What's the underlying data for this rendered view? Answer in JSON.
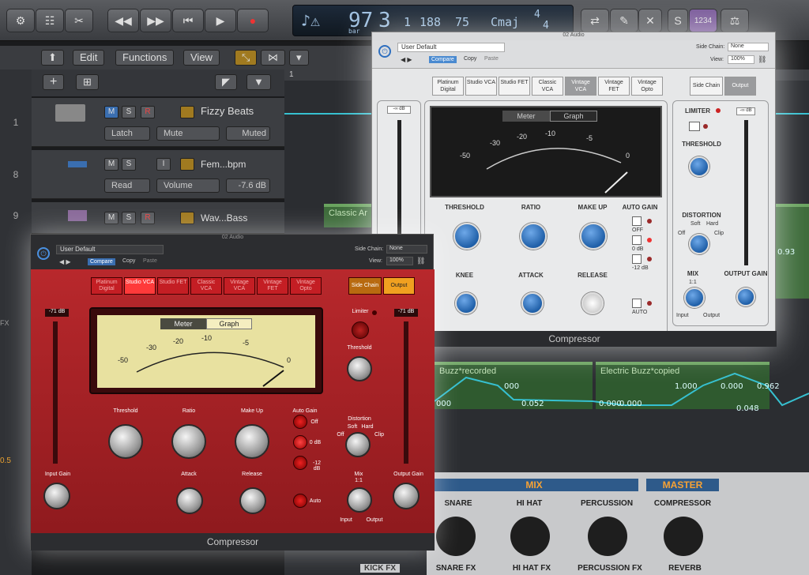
{
  "transport": {
    "bar": "97",
    "beat": "3",
    "division": "1",
    "tick": "188",
    "tempo": "75",
    "key": "Cmaj",
    "sig_top": "4",
    "sig_bottom": "4",
    "lcd_sub": "bar",
    "counter": "1234"
  },
  "toolbar": {
    "edit": "Edit",
    "functions": "Functions",
    "view": "View"
  },
  "tracks": [
    {
      "num": "1",
      "name": "Fizzy Beats",
      "m": "M",
      "s": "S",
      "r": "R",
      "mode": "Latch",
      "param": "Mute",
      "value": "Muted"
    },
    {
      "num": "8",
      "name": "Fem...bpm",
      "m": "M",
      "s": "S",
      "r": "I",
      "mode": "Read",
      "param": "Volume",
      "value": "-7.6 dB"
    },
    {
      "num": "9",
      "name": "Wav...Bass",
      "m": "M",
      "s": "S",
      "r": "R"
    }
  ],
  "ruler": {
    "start": "1"
  },
  "regions": {
    "classic": "Classic Ar",
    "buzz_rec": "Buzz*recorded",
    "buzz_copy": "Electric Buzz*copied",
    "side_val": "0.93"
  },
  "auto_values": [
    "000",
    "0.052",
    "000",
    "0.000",
    "0.000",
    "1.000",
    "0.000",
    "0.048",
    "0.962"
  ],
  "white_plugin": {
    "window": "02 Audio",
    "preset": "User Default",
    "compare": "Compare",
    "copy": "Copy",
    "paste": "Paste",
    "sidechain_label": "Side Chain:",
    "sidechain_val": "None",
    "view_label": "View:",
    "view_val": "100%",
    "models": [
      "Platinum Digital",
      "Studio VCA",
      "Studio FET",
      "Classic VCA",
      "Vintage VCA",
      "Vintage FET",
      "Vintage Opto"
    ],
    "active_model": "Vintage VCA",
    "side_chain_btn": "Side Chain",
    "output_btn": "Output",
    "in_db": "-∞ dB",
    "out_db": "-∞ dB",
    "meter_tab": "Meter",
    "graph_tab": "Graph",
    "vu_ticks": [
      "-50",
      "-30",
      "-20",
      "-10",
      "-5",
      "0"
    ],
    "threshold": "THRESHOLD",
    "ratio": "RATIO",
    "makeup": "MAKE UP",
    "autogain": "AUTO GAIN",
    "knee": "KNEE",
    "attack": "ATTACK",
    "release": "RELEASE",
    "auto": "AUTO",
    "ag_off": "OFF",
    "ag_0": "0 dB",
    "ag_12": "-12 dB",
    "limiter": "LIMITER",
    "lim_threshold": "THRESHOLD",
    "distortion": "DISTORTION",
    "dist_soft": "Soft",
    "dist_hard": "Hard",
    "dist_off": "Off",
    "dist_clip": "Clip",
    "mix": "MIX",
    "mix_input": "Input",
    "mix_output": "Output",
    "mix_ratio": "1:1",
    "output_gain": "OUTPUT GAIN",
    "footer": "Compressor"
  },
  "red_plugin": {
    "window": "02 Audio",
    "preset": "User Default",
    "compare": "Compare",
    "copy": "Copy",
    "paste": "Paste",
    "sidechain_label": "Side Chain:",
    "sidechain_val": "None",
    "view_label": "View:",
    "view_val": "100%",
    "models": [
      "Platinum Digital",
      "Studio VCA",
      "Studio FET",
      "Classic VCA",
      "Vintage VCA",
      "Vintage FET",
      "Vintage Opto"
    ],
    "active_model": "Studio VCA",
    "side_chain_btn": "Side Chain",
    "output_btn": "Output",
    "in_db": "-71 dB",
    "out_db": "-71 dB",
    "meter_tab": "Meter",
    "graph_tab": "Graph",
    "vu_ticks": [
      "-50",
      "-30",
      "-20",
      "-10",
      "-5",
      "0"
    ],
    "threshold": "Threshold",
    "ratio": "Ratio",
    "makeup": "Make Up",
    "autogain": "Auto Gain",
    "attack": "Attack",
    "release": "Release",
    "auto": "Auto",
    "ag_off": "Off",
    "ag_0": "0 dB",
    "ag_12": "-12 dB",
    "input_gain": "Input Gain",
    "limiter": "Limiter",
    "lim_threshold": "Threshold",
    "distortion": "Distortion",
    "dist_soft": "Soft",
    "dist_hard": "Hard",
    "dist_off": "Off",
    "dist_clip": "Clip",
    "mix": "Mix",
    "mix_ratio": "1:1",
    "mix_input": "Input",
    "mix_output": "Output",
    "output_gain": "Output Gain",
    "footer": "Compressor"
  },
  "mixer": {
    "mix": "MIX",
    "master": "MASTER",
    "snare": "SNARE",
    "hihat": "HI HAT",
    "percussion": "PERCUSSION",
    "compressor": "COMPRESSOR",
    "snare_fx": "SNARE FX",
    "hihat_fx": "HI HAT FX",
    "perc_fx": "PERCUSSION FX",
    "reverb": "REVERB",
    "kick_fx": "KICK FX"
  },
  "side_values": {
    "v1": "0.5",
    "v2": "FX"
  },
  "colors": {
    "accent_blue": "#2e6fbf",
    "red_panel": "#b8282c",
    "region_green": "#3d6b3a",
    "automation": "#36c0d0"
  }
}
